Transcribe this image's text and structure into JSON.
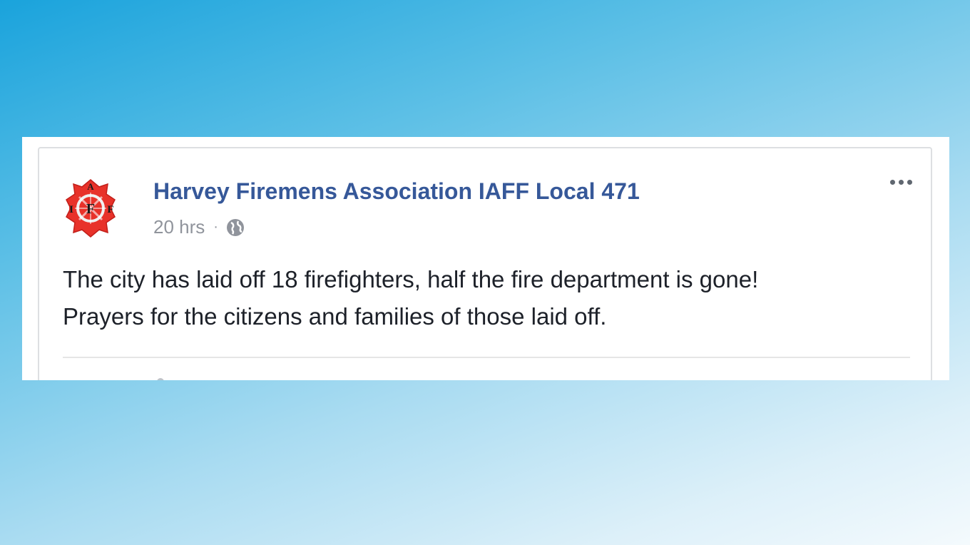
{
  "post": {
    "page_name": "Harvey Firemens Association IAFF Local 471",
    "timestamp": "20 hrs",
    "separator": "·",
    "privacy_icon": "globe-icon",
    "more_icon": "more-options-icon",
    "text_lines": [
      "The city has laid off 18 firefighters, half the fire department is gone!",
      "Prayers for the citizens and families of those laid off."
    ],
    "avatar": {
      "icon": "iaff-logo",
      "letters": [
        "I",
        "A",
        "F",
        "F"
      ]
    }
  },
  "colors": {
    "link_blue": "#365899",
    "meta_gray": "#90949c",
    "body_text": "#1d2129",
    "logo_red": "#e8322a"
  }
}
